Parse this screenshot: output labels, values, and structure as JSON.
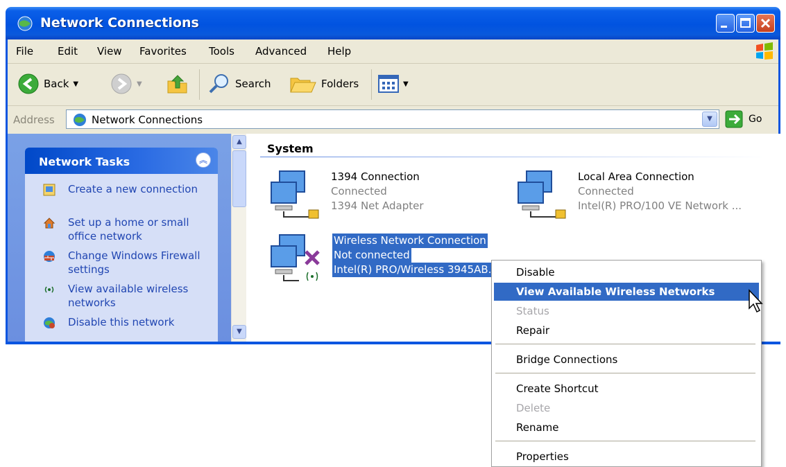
{
  "window": {
    "title": "Network Connections"
  },
  "menubar": {
    "items": [
      "File",
      "Edit",
      "View",
      "Favorites",
      "Tools",
      "Advanced",
      "Help"
    ]
  },
  "toolbar": {
    "back": "Back",
    "search": "Search",
    "folders": "Folders"
  },
  "address": {
    "label": "Address",
    "value": "Network Connections",
    "go": "Go"
  },
  "tasks": {
    "title": "Network Tasks",
    "items": [
      {
        "label": "Create a new connection",
        "icon": "new-connection-icon"
      },
      {
        "label": "Set up a home or small office network",
        "icon": "home-network-icon"
      },
      {
        "label": "Change Windows Firewall settings",
        "icon": "firewall-icon"
      },
      {
        "label": "View available wireless networks",
        "icon": "wireless-icon"
      },
      {
        "label": "Disable this network",
        "icon": "disable-network-icon"
      }
    ]
  },
  "group": {
    "title": "System"
  },
  "connections": [
    {
      "name": "1394 Connection",
      "status": "Connected",
      "device": "1394 Net Adapter"
    },
    {
      "name": "Local Area Connection",
      "status": "Connected",
      "device": "Intel(R) PRO/100 VE Network ..."
    },
    {
      "name": "Wireless Network Connection",
      "status": "Not connected",
      "device": "Intel(R) PRO/Wireless 3945AB."
    }
  ],
  "context_menu": {
    "items": [
      {
        "label": "Disable",
        "state": "normal"
      },
      {
        "label": "View Available Wireless Networks",
        "state": "highlighted"
      },
      {
        "label": "Status",
        "state": "disabled"
      },
      {
        "label": "Repair",
        "state": "normal"
      },
      {
        "label": "Bridge Connections",
        "state": "normal"
      },
      {
        "label": "Create Shortcut",
        "state": "normal"
      },
      {
        "label": "Delete",
        "state": "disabled"
      },
      {
        "label": "Rename",
        "state": "normal"
      },
      {
        "label": "Properties",
        "state": "normal"
      }
    ]
  },
  "colors": {
    "title_blue": "#0153e0",
    "selection": "#316ac5",
    "task_link": "#2146b2"
  }
}
